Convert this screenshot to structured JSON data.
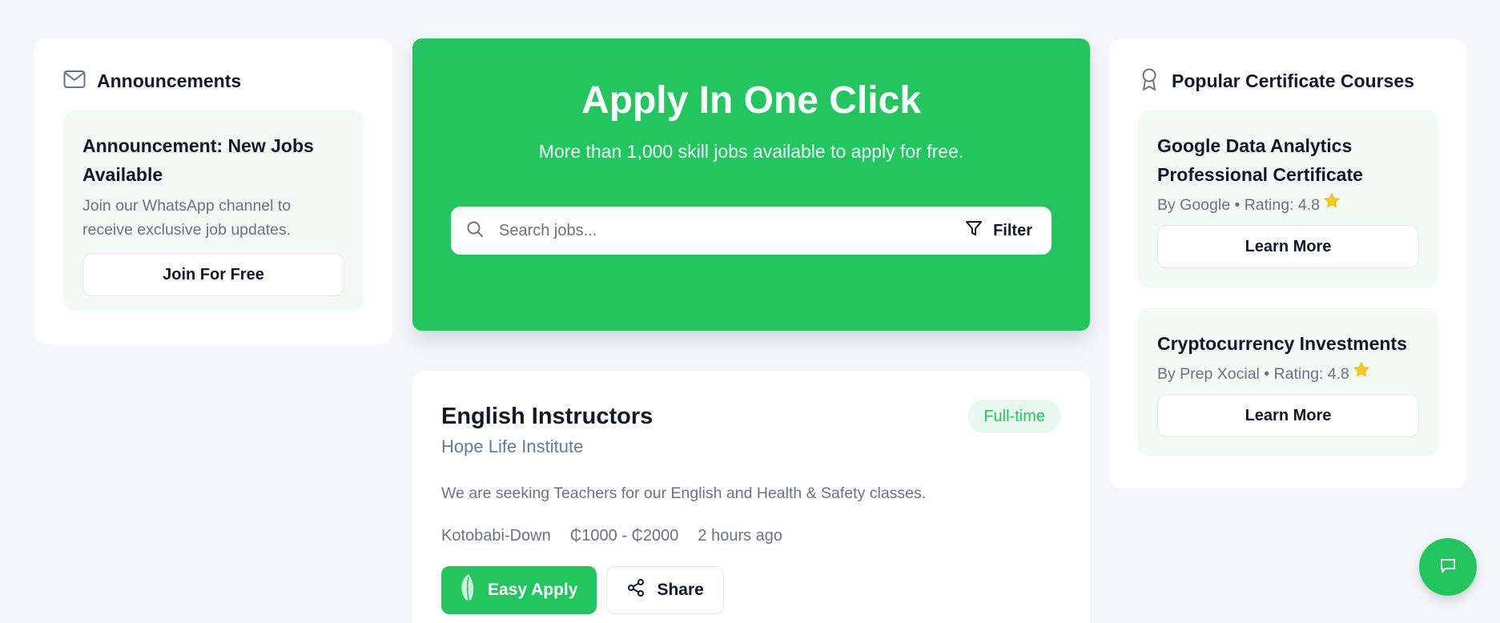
{
  "announcements": {
    "heading": "Announcements",
    "icon": "mail-icon",
    "item": {
      "title": "Announcement: New Jobs Available",
      "description": "Join our WhatsApp channel to receive exclusive job updates.",
      "button_label": "Join For Free"
    }
  },
  "hero": {
    "title": "Apply In One Click",
    "subtitle": "More than 1,000 skill jobs available to apply for free.",
    "search": {
      "placeholder": "Search jobs...",
      "icon": "search-icon"
    },
    "filter_label": "Filter",
    "filter_icon": "filter-icon"
  },
  "job": {
    "title": "English Instructors",
    "company": "Hope Life Institute",
    "type_badge": "Full-time",
    "description": "We are seeking Teachers for our English and Health & Safety classes.",
    "location": "Kotobabi-Down",
    "salary": "₵1000 - ₵2000",
    "posted": "2 hours ago",
    "apply_label": "Easy Apply",
    "share_label": "Share"
  },
  "courses": {
    "heading": "Popular Certificate Courses",
    "icon": "award-icon",
    "items": [
      {
        "title": "Google Data Analytics Professional Certificate",
        "meta": "By Google • Rating: 4.8",
        "button_label": "Learn More"
      },
      {
        "title": "Cryptocurrency Investments",
        "meta": "By Prep Xocial • Rating: 4.8",
        "button_label": "Learn More"
      }
    ]
  },
  "colors": {
    "accent": "#22c55e",
    "page_bg": "#f5f6f9",
    "soft_green": "#f1faf4",
    "muted_text": "#6b7280",
    "star": "#facc15"
  }
}
